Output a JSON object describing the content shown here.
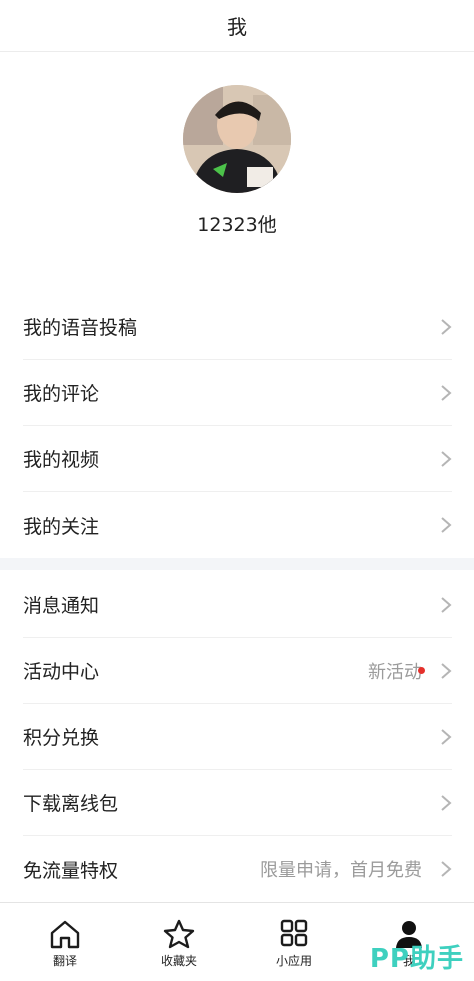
{
  "header": {
    "title": "我"
  },
  "profile": {
    "username": "12323他"
  },
  "section1": {
    "items": [
      {
        "label": "我的语音投稿"
      },
      {
        "label": "我的评论"
      },
      {
        "label": "我的视频"
      },
      {
        "label": "我的关注"
      }
    ]
  },
  "section2": {
    "items": [
      {
        "label": "消息通知"
      },
      {
        "label": "活动中心",
        "extra": "新活动"
      },
      {
        "label": "积分兑换"
      },
      {
        "label": "下载离线包"
      },
      {
        "label": "免流量特权",
        "extra": "限量申请，首月免费"
      }
    ]
  },
  "tabbar": {
    "tabs": [
      {
        "label": "翻译",
        "icon": "home-icon"
      },
      {
        "label": "收藏夹",
        "icon": "star-icon"
      },
      {
        "label": "小应用",
        "icon": "grid-icon"
      },
      {
        "label": "我",
        "icon": "person-icon"
      }
    ]
  },
  "watermark": {
    "text": "PP助手"
  },
  "colors": {
    "accent_dot": "#e5302b",
    "watermark": "#3ed0bf",
    "divider": "#efefef"
  }
}
